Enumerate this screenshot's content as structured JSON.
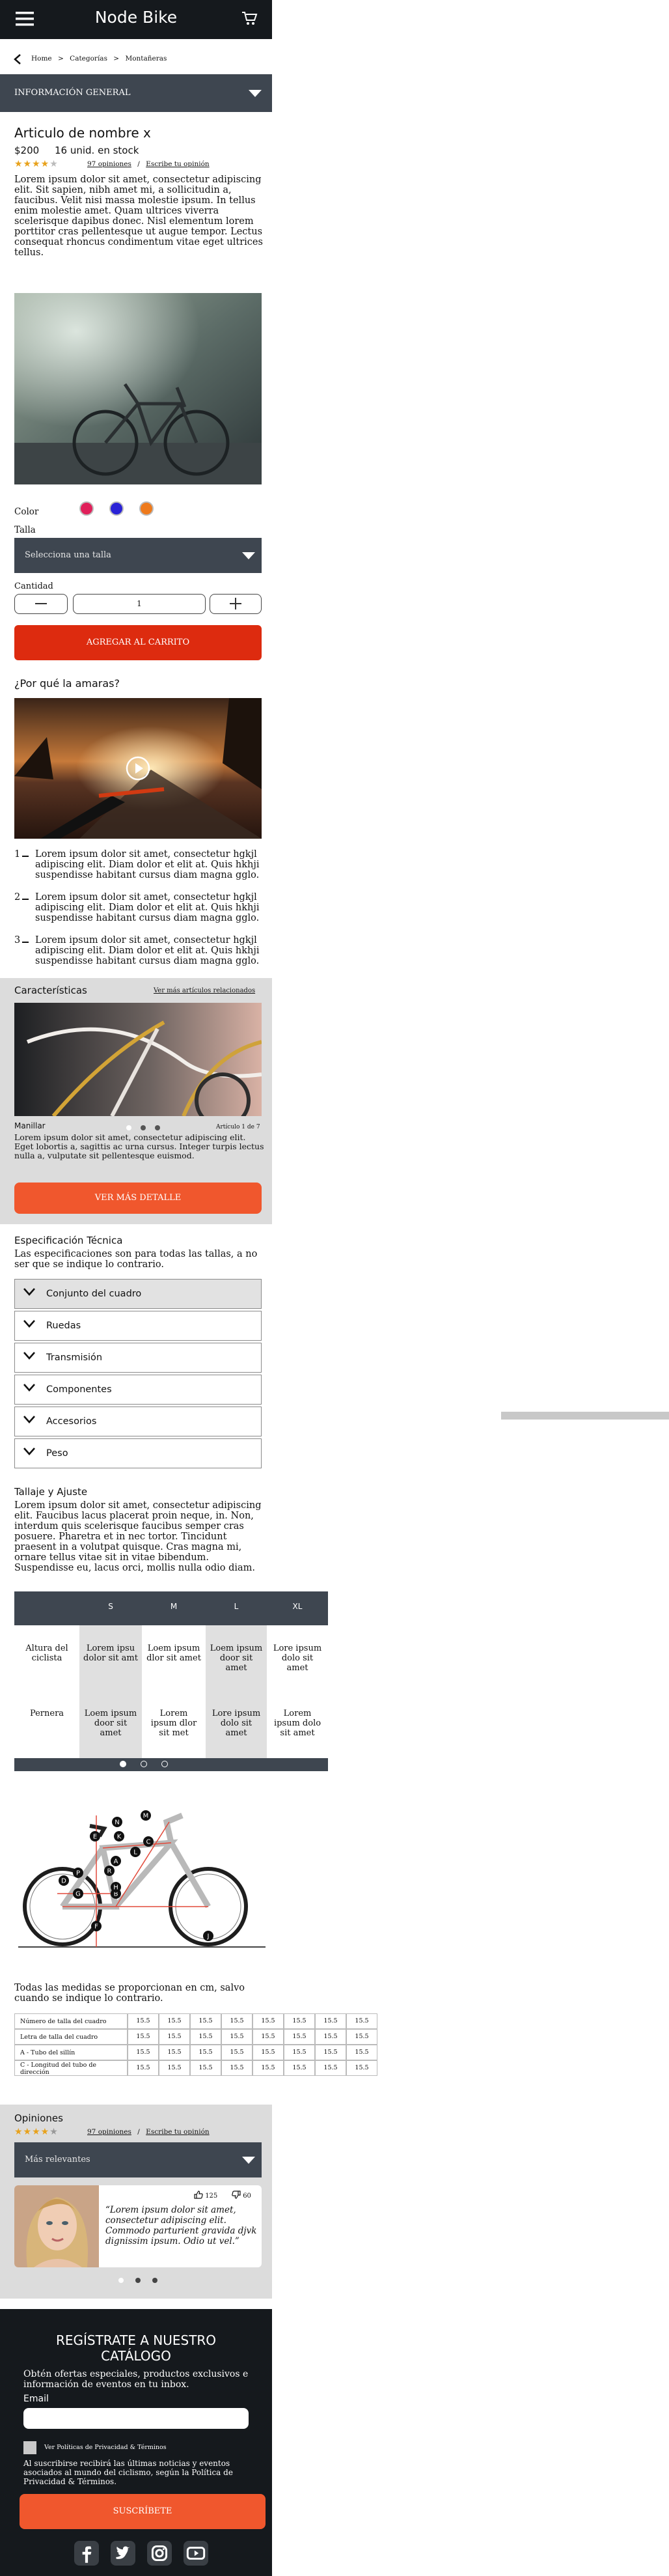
{
  "header": {
    "title": "Node Bike"
  },
  "breadcrumb": {
    "home": "Home",
    "sep1": ">",
    "categories": "Categorías",
    "sep2": ">",
    "current": "Montañeras"
  },
  "general_info_bar": {
    "label": "INFORMACIÓN GENERAL"
  },
  "product": {
    "name": "Articulo de nombre x",
    "price": "$200",
    "stock": "16 unid. en stock",
    "rating_stars": 4,
    "reviews_link": "97 opiniones",
    "review_sep": "/",
    "write_review": "Escribe tu opinión",
    "description": "Lorem ipsum dolor sit amet, consectetur adipiscing elit. Sit sapien, nibh amet mi, a sollicitudin a, faucibus. Velit nisi massa molestie ipsum. In tellus enim molestie amet. Quam ultrices viverra scelerisque dapibus donec. Nisl elementum lorem porttitor cras pellentesque ut augue tempor. Lectus consequat rhoncus condimentum vitae eget ultrices tellus.",
    "color_label": "Color",
    "colors": [
      "#e0205a",
      "#2a22d6",
      "#ee7a1c"
    ],
    "size_label": "Talla",
    "size_placeholder": "Selecciona una talla",
    "quantity_label": "Cantidad",
    "quantity_value": "1",
    "add_to_cart": "AGREGAR AL CARRITO"
  },
  "why": {
    "title": "¿Por qué la amaras?",
    "items": [
      {
        "num": "1",
        "text": "Lorem ipsum dolor sit amet, consectetur hgkjl adipiscing elit. Diam dolor et elit at. Quis hkhji suspendisse habitant cursus diam magna gglo."
      },
      {
        "num": "2",
        "text": "Lorem ipsum dolor sit amet, consectetur hgkjl adipiscing elit. Diam dolor et elit at. Quis hkhji suspendisse habitant cursus diam magna gglo."
      },
      {
        "num": "3",
        "text": "Lorem ipsum dolor sit amet, consectetur hgkjl adipiscing elit. Diam dolor et elit at. Quis hkhji suspendisse habitant cursus diam magna gglo."
      }
    ]
  },
  "features": {
    "title": "Características",
    "related_link": "Ver más artículos relacionados",
    "item_title": "Manillar",
    "counter": "Artículo 1 de 7",
    "text": "Lorem ipsum dolor sit amet, consectetur adipiscing elit. Eget lobortis a, sagittis ac urna cursus. Integer turpis lectus nulla a, vulputate sit pellentesque euismod.",
    "button": "VER MÁS DETALLE"
  },
  "tech_spec": {
    "title": "Especificación Técnica",
    "intro": "Las especificaciones son para todas las tallas, a no ser que se indique lo contrario.",
    "sections": [
      "Conjunto del cuadro",
      "Ruedas",
      "Transmisión",
      "Componentes",
      "Accesorios",
      "Peso"
    ]
  },
  "sizing": {
    "title": "Tallaje y Ajuste",
    "text": "Lorem ipsum dolor sit amet, consectetur adipiscing elit. Faucibus lacus placerat proin neque, in. Non, interdum quis scelerisque faucibus semper cras posuere. Pharetra et in nec tortor. Tincidunt praesent in a volutpat quisque. Cras magna mi, ornare tellus vitae sit in vitae bibendum. Suspendisse eu, lacus orci, mollis nulla odio diam.",
    "headers": [
      "",
      "S",
      "M",
      "L",
      "XL"
    ],
    "rows": [
      {
        "label": "Altura del ciclista",
        "cells": [
          "Lorem ipsu dolor sit amt",
          "Loem ipsum dlor sit amet",
          "Loem ipsum door sit amet",
          "Lore ipsum dolo sit amet"
        ]
      },
      {
        "label": "Pernera",
        "cells": [
          "Loem ipsum door sit amet",
          "Lorem ipsum dlor sit met",
          "Lore ipsum dolo sit amet",
          "Lorem ipsum dolo sit amet"
        ]
      }
    ],
    "diagram_labels": [
      "A",
      "B",
      "C",
      "D",
      "E",
      "F",
      "G",
      "H",
      "J",
      "K",
      "L",
      "M",
      "N",
      "P",
      "R"
    ],
    "note": "Todas las medidas se proporcionan en cm, salvo cuando se indique lo contrario.",
    "spec_rows": [
      "Número de talla del cuadro",
      "Letra de talla del cuadro",
      "A - Tubo del sillín",
      "C - Longitud del tubo de dirección"
    ],
    "spec_value": "15.5"
  },
  "opinions": {
    "title": "Opiniones",
    "reviews_link": "97 opiniones",
    "sep": "/",
    "write": "Escribe tu opinión",
    "sort": "Más relevantes",
    "likes": "125",
    "dislikes": "60",
    "quote": "“Lorem ipsum dolor sit amet, consectetur adipiscing elit. Commodo parturient gravida djvk dignissim ipsum. Odio ut vel.”"
  },
  "newsletter": {
    "title": "REGÍSTRATE A NUESTRO CATÁLOGO",
    "subtitle": "Obtén ofertas especiales, productos exclusivos e información de eventos en tu inbox.",
    "email_label": "Email",
    "policy": "Ver Políticas de Privacidad & Términos",
    "disclaimer": "Al suscribirse recibirá las últimas noticias y eventos asociados al mundo del ciclismo, según la Política de Privacidad & Términos.",
    "button": "SUSCRÍBETE"
  },
  "social": [
    "facebook-icon",
    "twitter-icon",
    "instagram-icon",
    "youtube-icon"
  ]
}
